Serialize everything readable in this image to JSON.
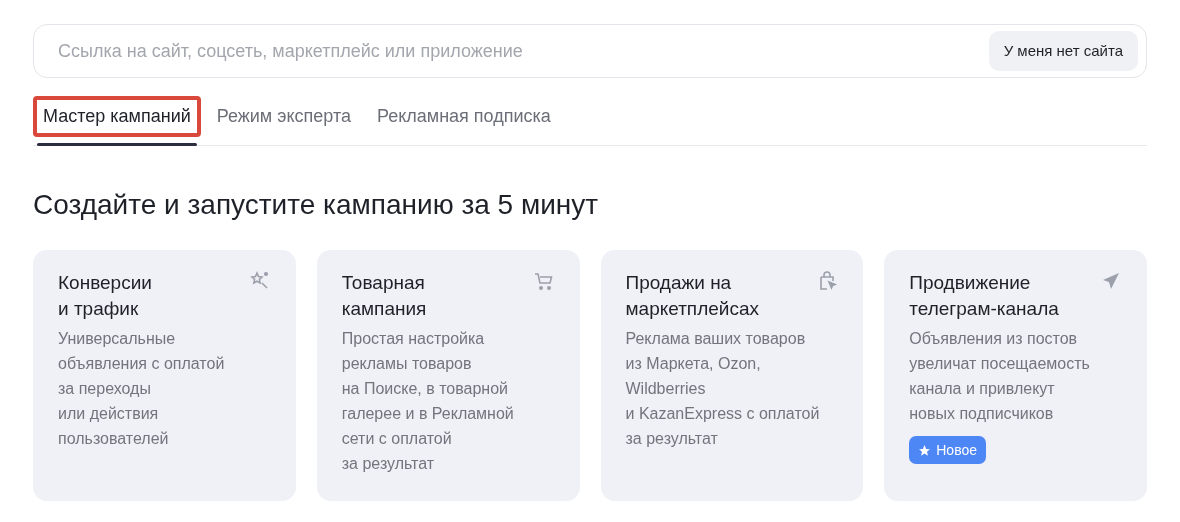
{
  "search": {
    "placeholder": "Ссылка на сайт, соцсеть, маркетплейс или приложение",
    "button": "У меня нет сайта"
  },
  "tabs": [
    {
      "label": "Мастер кампаний",
      "selected": true,
      "highlighted": true
    },
    {
      "label": "Режим эксперта",
      "selected": false,
      "highlighted": false
    },
    {
      "label": "Рекламная подписка",
      "selected": false,
      "highlighted": false
    }
  ],
  "heading": "Создайте и запустите кампанию за 5 минут",
  "cards": [
    {
      "title": "Конверсии\nи трафик",
      "kind": "magic",
      "description": "Универсальные\nобъявления с оплатой\nза переходы\nили действия\nпользователей"
    },
    {
      "title": "Товарная\nкампания",
      "kind": "cart",
      "description": "Простая настройка\nрекламы товаров\nна Поиске, в товарной\nгалерее и в Рекламной\nсети с оплатой\nза результат"
    },
    {
      "title": "Продажи на\nмаркетплейсах",
      "kind": "bag",
      "description": "Реклама ваших товаров\nиз Маркета, Ozon,\nWildberries\nи KazanExpress с оплатой\nза результат"
    },
    {
      "title": "Продвижение\nтелеграм-канала",
      "kind": "plane",
      "description": "Объявления из постов\nувеличат посещаемость\nканала и привлекут\nновых подписчиков",
      "badge": "Новое"
    }
  ]
}
